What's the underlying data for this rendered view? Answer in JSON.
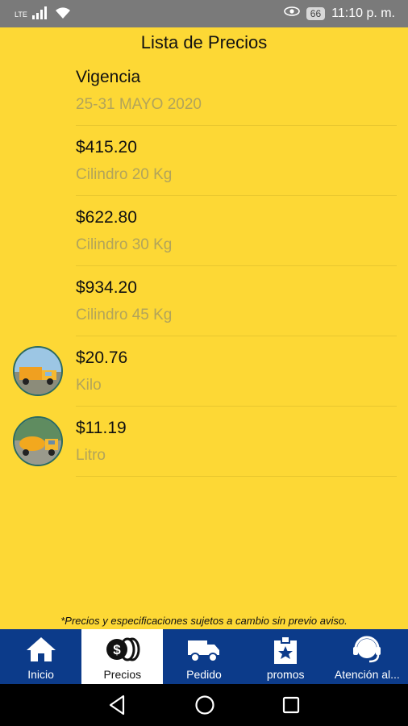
{
  "status_bar": {
    "network_label": "LTE",
    "battery": "66",
    "time": "11:10 p. m."
  },
  "header": {
    "title": "Lista de Precios"
  },
  "validity": {
    "label": "Vigencia",
    "dates": "25-31 MAYO 2020"
  },
  "prices": [
    {
      "price": "$415.20",
      "product": "Cilindro 20 Kg"
    },
    {
      "price": "$622.80",
      "product": "Cilindro 30 Kg"
    },
    {
      "price": "$934.20",
      "product": "Cilindro 45 Kg"
    },
    {
      "price": "$20.76",
      "product": "Kilo"
    },
    {
      "price": "$11.19",
      "product": "Litro"
    }
  ],
  "disclaimer": "*Precios y especificaciones sujetos a cambio sin previo aviso.",
  "tabs": [
    {
      "label": "Inicio",
      "icon": "home-icon"
    },
    {
      "label": "Precios",
      "icon": "coins-icon",
      "active": true
    },
    {
      "label": "Pedido",
      "icon": "delivery-truck-icon"
    },
    {
      "label": "promos",
      "icon": "promo-badge-icon"
    },
    {
      "label": "Atención al...",
      "icon": "headset-support-icon"
    }
  ],
  "colors": {
    "background": "#fdd835",
    "tab_bar": "#0c3b8a",
    "secondary_text": "#b2a45a"
  }
}
